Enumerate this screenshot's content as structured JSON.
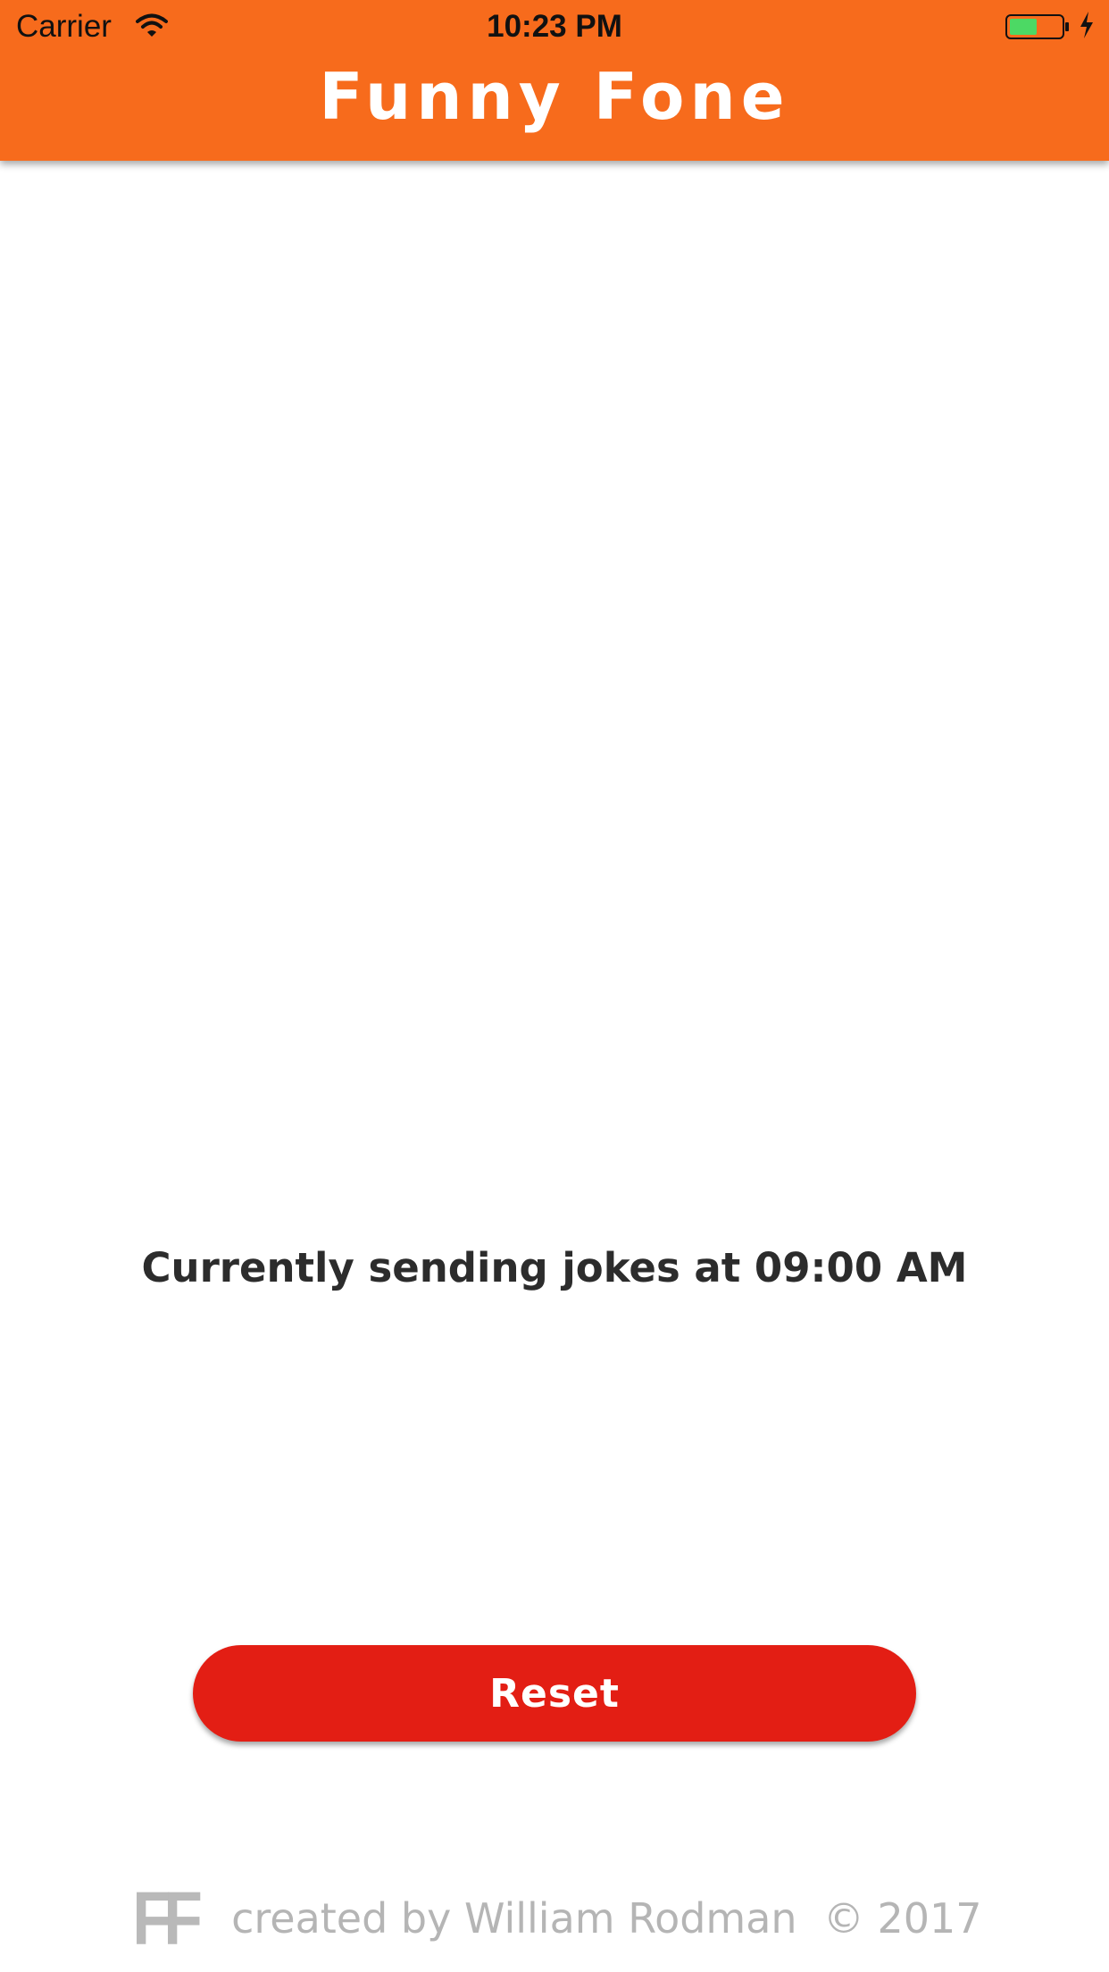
{
  "status_bar": {
    "carrier": "Carrier",
    "time": "10:23 PM",
    "battery_color": "#4cd964"
  },
  "app": {
    "title": "Funny Fone",
    "accent_color": "#f76b1c"
  },
  "main": {
    "schedule_text": "Currently sending jokes at 09:00 AM"
  },
  "actions": {
    "reset_label": "Reset",
    "reset_color": "#e31e14"
  },
  "footer": {
    "logo": "FF",
    "credit": "created by William Rodman  © 2017"
  }
}
